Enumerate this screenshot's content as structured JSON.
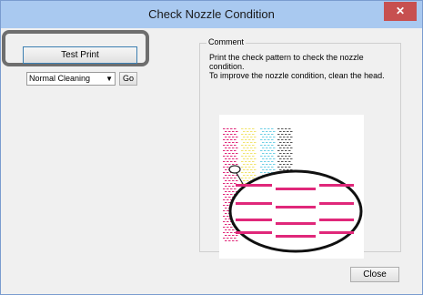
{
  "window": {
    "title": "Check Nozzle Condition",
    "close_glyph": "✕"
  },
  "actions": {
    "test_print_label": "Test Print",
    "cleaning_selected": "Normal Cleaning",
    "go_label": "Go",
    "close_label": "Close"
  },
  "comment": {
    "group_label": "Comment",
    "line1": "Print the check pattern to check the nozzle condition.",
    "line2": "To improve the nozzle condition, clean the head."
  },
  "colors": {
    "titlebar": "#a9c9f0",
    "magenta": "#e0287a",
    "yellow": "#f2e46e",
    "cyan": "#6fd0e6",
    "black": "#555555"
  }
}
